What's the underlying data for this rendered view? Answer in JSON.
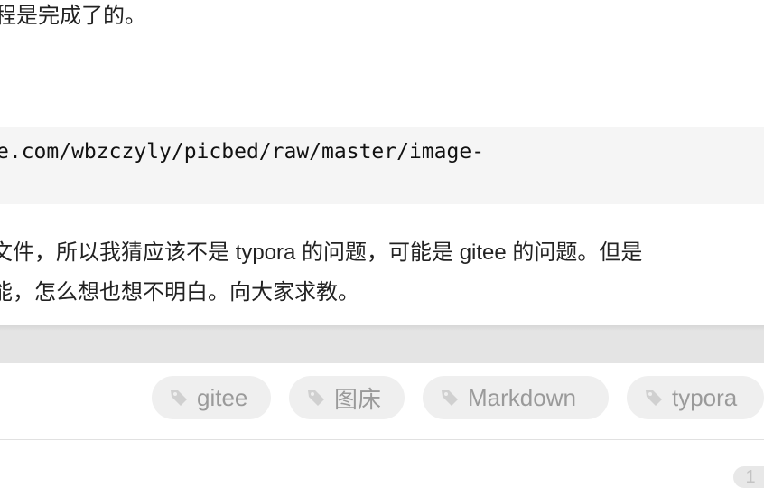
{
  "post": {
    "top_line": "程是完成了的。",
    "code_line": "e.com/wbzczyly/picbed/raw/master/image-",
    "para_line1": "文件，所以我猜应该不是 typora 的问题，可能是 gitee 的问题。但是",
    "para_line2": "能，怎么想也想不明白。向大家求教。"
  },
  "tags": [
    {
      "label": "gitee",
      "icon": "tag-icon"
    },
    {
      "label": "图床",
      "icon": "tag-icon"
    },
    {
      "label": "Markdown",
      "icon": "tag-icon"
    },
    {
      "label": "typora",
      "icon": "tag-icon"
    }
  ],
  "footer": {
    "count": "1"
  }
}
